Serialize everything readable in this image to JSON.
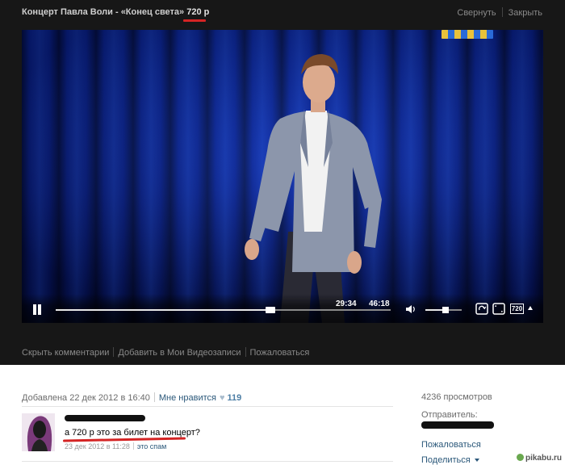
{
  "header": {
    "title_prefix": "Концерт Павла Воли - «Конец света»",
    "quality_label": "720 р",
    "collapse_label": "Свернуть",
    "close_label": "Закрыть"
  },
  "player": {
    "time_current": "29:34",
    "time_total": "46:18",
    "progress_fraction": 0.64,
    "volume_fraction": 0.55,
    "quality_button": "720"
  },
  "actions": {
    "hide_comments": "Скрыть комментарии",
    "add_to_videos": "Добавить в Мои Видеозаписи",
    "report": "Пожаловаться"
  },
  "info": {
    "added": "Добавлена 22 дек 2012 в 16:40",
    "like_label": "Мне нравится",
    "like_count": "119"
  },
  "comment": {
    "text": "а 720 р это за билет на концерт?",
    "date": "23 дек 2012 в 11:28",
    "spam_label": "это спам"
  },
  "sidebar": {
    "views": "4236 просмотров",
    "sender_label": "Отправитель:",
    "report_label": "Пожаловаться",
    "share_label": "Поделиться"
  },
  "watermark": "pikabu.ru",
  "colors": {
    "panel_bg": "#171717",
    "curtain_blue": "#0b2aa8",
    "link_blue": "#2b587a",
    "highlight_red": "#d42424"
  },
  "icons": [
    "pause-icon",
    "volume-icon",
    "fullscreen-icon",
    "expand-icon",
    "chevron-up-icon",
    "heart-icon",
    "chevron-down-icon"
  ]
}
